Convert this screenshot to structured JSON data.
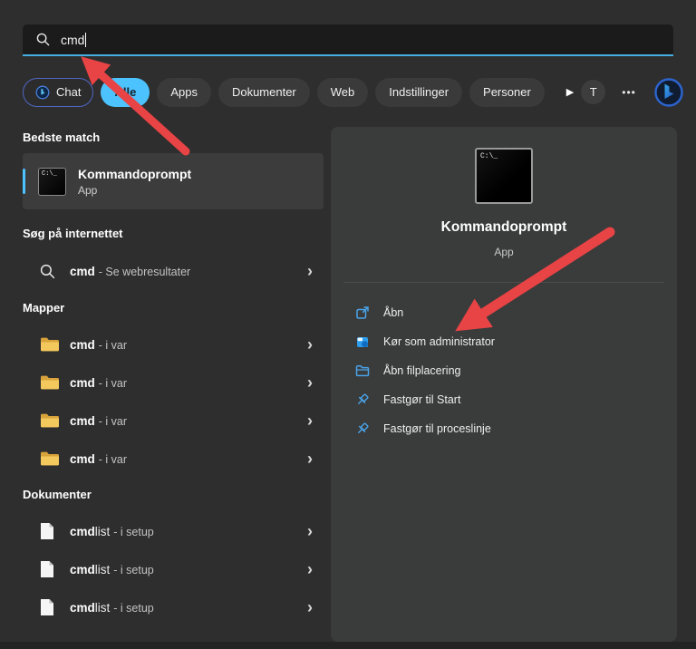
{
  "colors": {
    "accent_blue": "#4cc2ff",
    "link_blue": "#4aa3e8",
    "arrow_red": "#e84345",
    "folder_yellow": "#f0c04e"
  },
  "search_bar": {
    "value": "cmd"
  },
  "tab_bar": {
    "chat_label": "Chat",
    "filters": [
      {
        "label": "Alle"
      },
      {
        "label": "Apps"
      },
      {
        "label": "Dokumenter"
      },
      {
        "label": "Web"
      },
      {
        "label": "Indstillinger"
      },
      {
        "label": "Personer"
      }
    ],
    "selected_filter": "Alle",
    "overflow_arrow": "▶",
    "account_initial": "T",
    "more": "•••"
  },
  "results": {
    "best_match": {
      "heading": "Bedste match",
      "item": {
        "title": "Kommandoprompt",
        "type": "App"
      }
    },
    "web": {
      "heading": "Søg på internettet",
      "item": {
        "query": "cmd",
        "suffix": "- Se webresultater"
      }
    },
    "folders": {
      "heading": "Mapper",
      "items": [
        {
          "name": "cmd",
          "location": "- i var"
        },
        {
          "name": "cmd",
          "location": "- i var"
        },
        {
          "name": "cmd",
          "location": "- i var"
        },
        {
          "name": "cmd",
          "location": "- i var"
        }
      ]
    },
    "documents": {
      "heading": "Dokumenter",
      "items": [
        {
          "match": "cmd",
          "rest": "list",
          "location": "- i setup"
        },
        {
          "match": "cmd",
          "rest": "list",
          "location": "- i setup"
        },
        {
          "match": "cmd",
          "rest": "list",
          "location": "- i setup"
        }
      ]
    }
  },
  "preview": {
    "title": "Kommandoprompt",
    "type": "App",
    "actions": [
      {
        "label": "Åbn"
      },
      {
        "label": "Kør som administrator"
      },
      {
        "label": "Åbn filplacering"
      },
      {
        "label": "Fastgør til Start"
      },
      {
        "label": "Fastgør til proceslinje"
      }
    ]
  }
}
